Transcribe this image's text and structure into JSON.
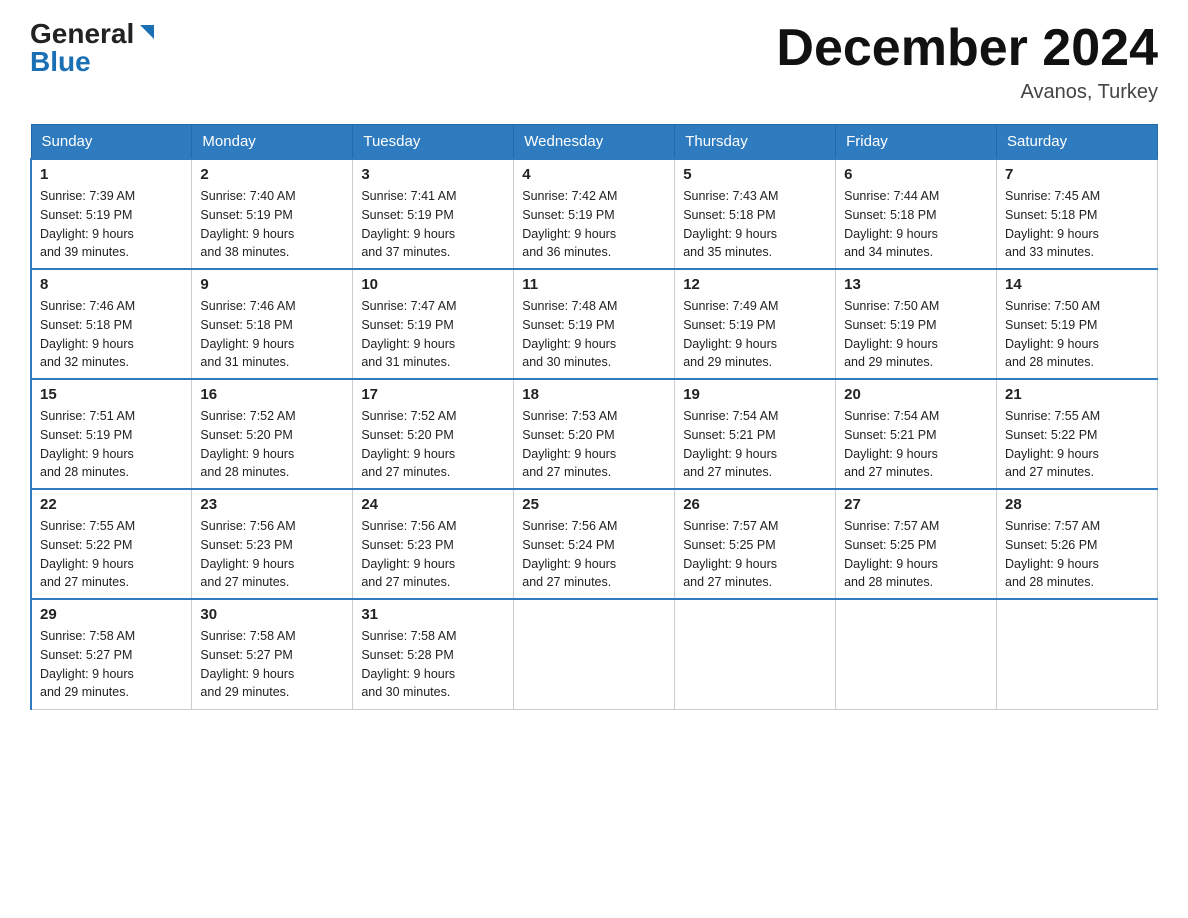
{
  "logo": {
    "general": "General",
    "blue": "Blue"
  },
  "title": "December 2024",
  "location": "Avanos, Turkey",
  "days_of_week": [
    "Sunday",
    "Monday",
    "Tuesday",
    "Wednesday",
    "Thursday",
    "Friday",
    "Saturday"
  ],
  "weeks": [
    [
      {
        "day": "1",
        "sunrise": "7:39 AM",
        "sunset": "5:19 PM",
        "daylight": "9 hours and 39 minutes."
      },
      {
        "day": "2",
        "sunrise": "7:40 AM",
        "sunset": "5:19 PM",
        "daylight": "9 hours and 38 minutes."
      },
      {
        "day": "3",
        "sunrise": "7:41 AM",
        "sunset": "5:19 PM",
        "daylight": "9 hours and 37 minutes."
      },
      {
        "day": "4",
        "sunrise": "7:42 AM",
        "sunset": "5:19 PM",
        "daylight": "9 hours and 36 minutes."
      },
      {
        "day": "5",
        "sunrise": "7:43 AM",
        "sunset": "5:18 PM",
        "daylight": "9 hours and 35 minutes."
      },
      {
        "day": "6",
        "sunrise": "7:44 AM",
        "sunset": "5:18 PM",
        "daylight": "9 hours and 34 minutes."
      },
      {
        "day": "7",
        "sunrise": "7:45 AM",
        "sunset": "5:18 PM",
        "daylight": "9 hours and 33 minutes."
      }
    ],
    [
      {
        "day": "8",
        "sunrise": "7:46 AM",
        "sunset": "5:18 PM",
        "daylight": "9 hours and 32 minutes."
      },
      {
        "day": "9",
        "sunrise": "7:46 AM",
        "sunset": "5:18 PM",
        "daylight": "9 hours and 31 minutes."
      },
      {
        "day": "10",
        "sunrise": "7:47 AM",
        "sunset": "5:19 PM",
        "daylight": "9 hours and 31 minutes."
      },
      {
        "day": "11",
        "sunrise": "7:48 AM",
        "sunset": "5:19 PM",
        "daylight": "9 hours and 30 minutes."
      },
      {
        "day": "12",
        "sunrise": "7:49 AM",
        "sunset": "5:19 PM",
        "daylight": "9 hours and 29 minutes."
      },
      {
        "day": "13",
        "sunrise": "7:50 AM",
        "sunset": "5:19 PM",
        "daylight": "9 hours and 29 minutes."
      },
      {
        "day": "14",
        "sunrise": "7:50 AM",
        "sunset": "5:19 PM",
        "daylight": "9 hours and 28 minutes."
      }
    ],
    [
      {
        "day": "15",
        "sunrise": "7:51 AM",
        "sunset": "5:19 PM",
        "daylight": "9 hours and 28 minutes."
      },
      {
        "day": "16",
        "sunrise": "7:52 AM",
        "sunset": "5:20 PM",
        "daylight": "9 hours and 28 minutes."
      },
      {
        "day": "17",
        "sunrise": "7:52 AM",
        "sunset": "5:20 PM",
        "daylight": "9 hours and 27 minutes."
      },
      {
        "day": "18",
        "sunrise": "7:53 AM",
        "sunset": "5:20 PM",
        "daylight": "9 hours and 27 minutes."
      },
      {
        "day": "19",
        "sunrise": "7:54 AM",
        "sunset": "5:21 PM",
        "daylight": "9 hours and 27 minutes."
      },
      {
        "day": "20",
        "sunrise": "7:54 AM",
        "sunset": "5:21 PM",
        "daylight": "9 hours and 27 minutes."
      },
      {
        "day": "21",
        "sunrise": "7:55 AM",
        "sunset": "5:22 PM",
        "daylight": "9 hours and 27 minutes."
      }
    ],
    [
      {
        "day": "22",
        "sunrise": "7:55 AM",
        "sunset": "5:22 PM",
        "daylight": "9 hours and 27 minutes."
      },
      {
        "day": "23",
        "sunrise": "7:56 AM",
        "sunset": "5:23 PM",
        "daylight": "9 hours and 27 minutes."
      },
      {
        "day": "24",
        "sunrise": "7:56 AM",
        "sunset": "5:23 PM",
        "daylight": "9 hours and 27 minutes."
      },
      {
        "day": "25",
        "sunrise": "7:56 AM",
        "sunset": "5:24 PM",
        "daylight": "9 hours and 27 minutes."
      },
      {
        "day": "26",
        "sunrise": "7:57 AM",
        "sunset": "5:25 PM",
        "daylight": "9 hours and 27 minutes."
      },
      {
        "day": "27",
        "sunrise": "7:57 AM",
        "sunset": "5:25 PM",
        "daylight": "9 hours and 28 minutes."
      },
      {
        "day": "28",
        "sunrise": "7:57 AM",
        "sunset": "5:26 PM",
        "daylight": "9 hours and 28 minutes."
      }
    ],
    [
      {
        "day": "29",
        "sunrise": "7:58 AM",
        "sunset": "5:27 PM",
        "daylight": "9 hours and 29 minutes."
      },
      {
        "day": "30",
        "sunrise": "7:58 AM",
        "sunset": "5:27 PM",
        "daylight": "9 hours and 29 minutes."
      },
      {
        "day": "31",
        "sunrise": "7:58 AM",
        "sunset": "5:28 PM",
        "daylight": "9 hours and 30 minutes."
      },
      null,
      null,
      null,
      null
    ]
  ],
  "labels": {
    "sunrise": "Sunrise:",
    "sunset": "Sunset:",
    "daylight": "Daylight:"
  }
}
